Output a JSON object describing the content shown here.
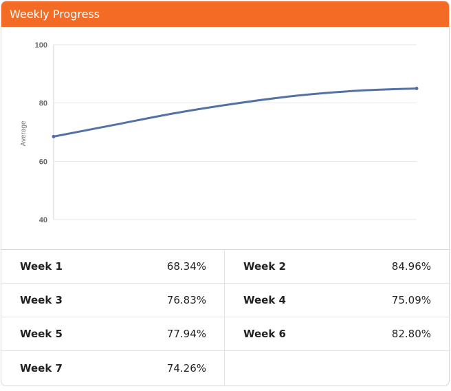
{
  "header": {
    "title": "Weekly Progress"
  },
  "colors": {
    "header": "#f36b24",
    "line": "#5471a6",
    "grid": "#e6e6e6"
  },
  "chart_data": {
    "type": "line",
    "title": "",
    "xlabel": "",
    "ylabel": "Average",
    "ylim": [
      40,
      100
    ],
    "yticks": [
      40,
      60,
      80,
      100
    ],
    "grid": true,
    "x": [
      0,
      1,
      2,
      3,
      4,
      5,
      6
    ],
    "series": [
      {
        "values": [
          68.5,
          72.5,
          76.5,
          79.8,
          82.5,
          84.2,
          85.0
        ]
      }
    ]
  },
  "stats": [
    {
      "label": "Week 1",
      "value": "68.34%"
    },
    {
      "label": "Week 2",
      "value": "84.96%"
    },
    {
      "label": "Week 3",
      "value": "76.83%"
    },
    {
      "label": "Week 4",
      "value": "75.09%"
    },
    {
      "label": "Week 5",
      "value": "77.94%"
    },
    {
      "label": "Week 6",
      "value": "82.80%"
    },
    {
      "label": "Week 7",
      "value": "74.26%"
    }
  ]
}
